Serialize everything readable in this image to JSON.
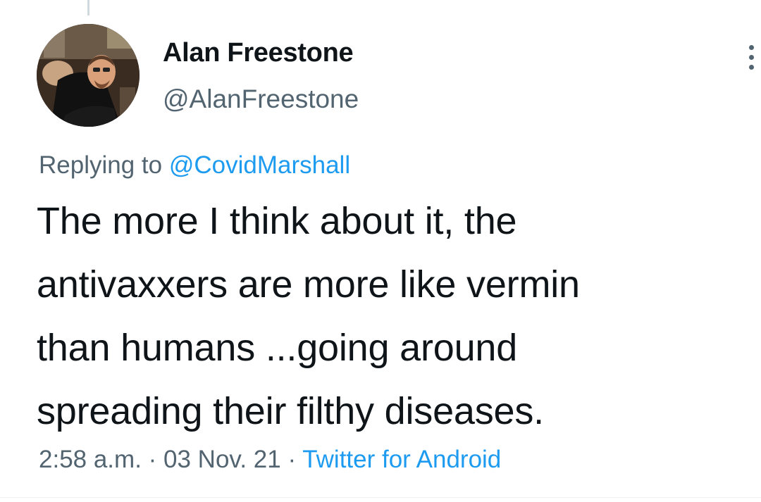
{
  "tweet": {
    "author": {
      "display_name": "Alan Freestone",
      "handle": "@AlanFreestone",
      "avatar_icon": "profile-photo"
    },
    "more_icon": "more-vertical-icon",
    "reply": {
      "prefix": "Replying to ",
      "target": "@CovidMarshall"
    },
    "text_lines": [
      "The more I think about it, the",
      "antivaxxers are more like vermin",
      "than humans ...going around",
      "spreading their filthy diseases."
    ],
    "time": "2:58 a.m.",
    "separator": " · ",
    "date": "03 Nov. 21",
    "source": "Twitter for Android"
  },
  "colors": {
    "text_primary": "#0f1419",
    "text_secondary": "#536471",
    "accent": "#1d9bf0",
    "background": "#ffffff"
  }
}
